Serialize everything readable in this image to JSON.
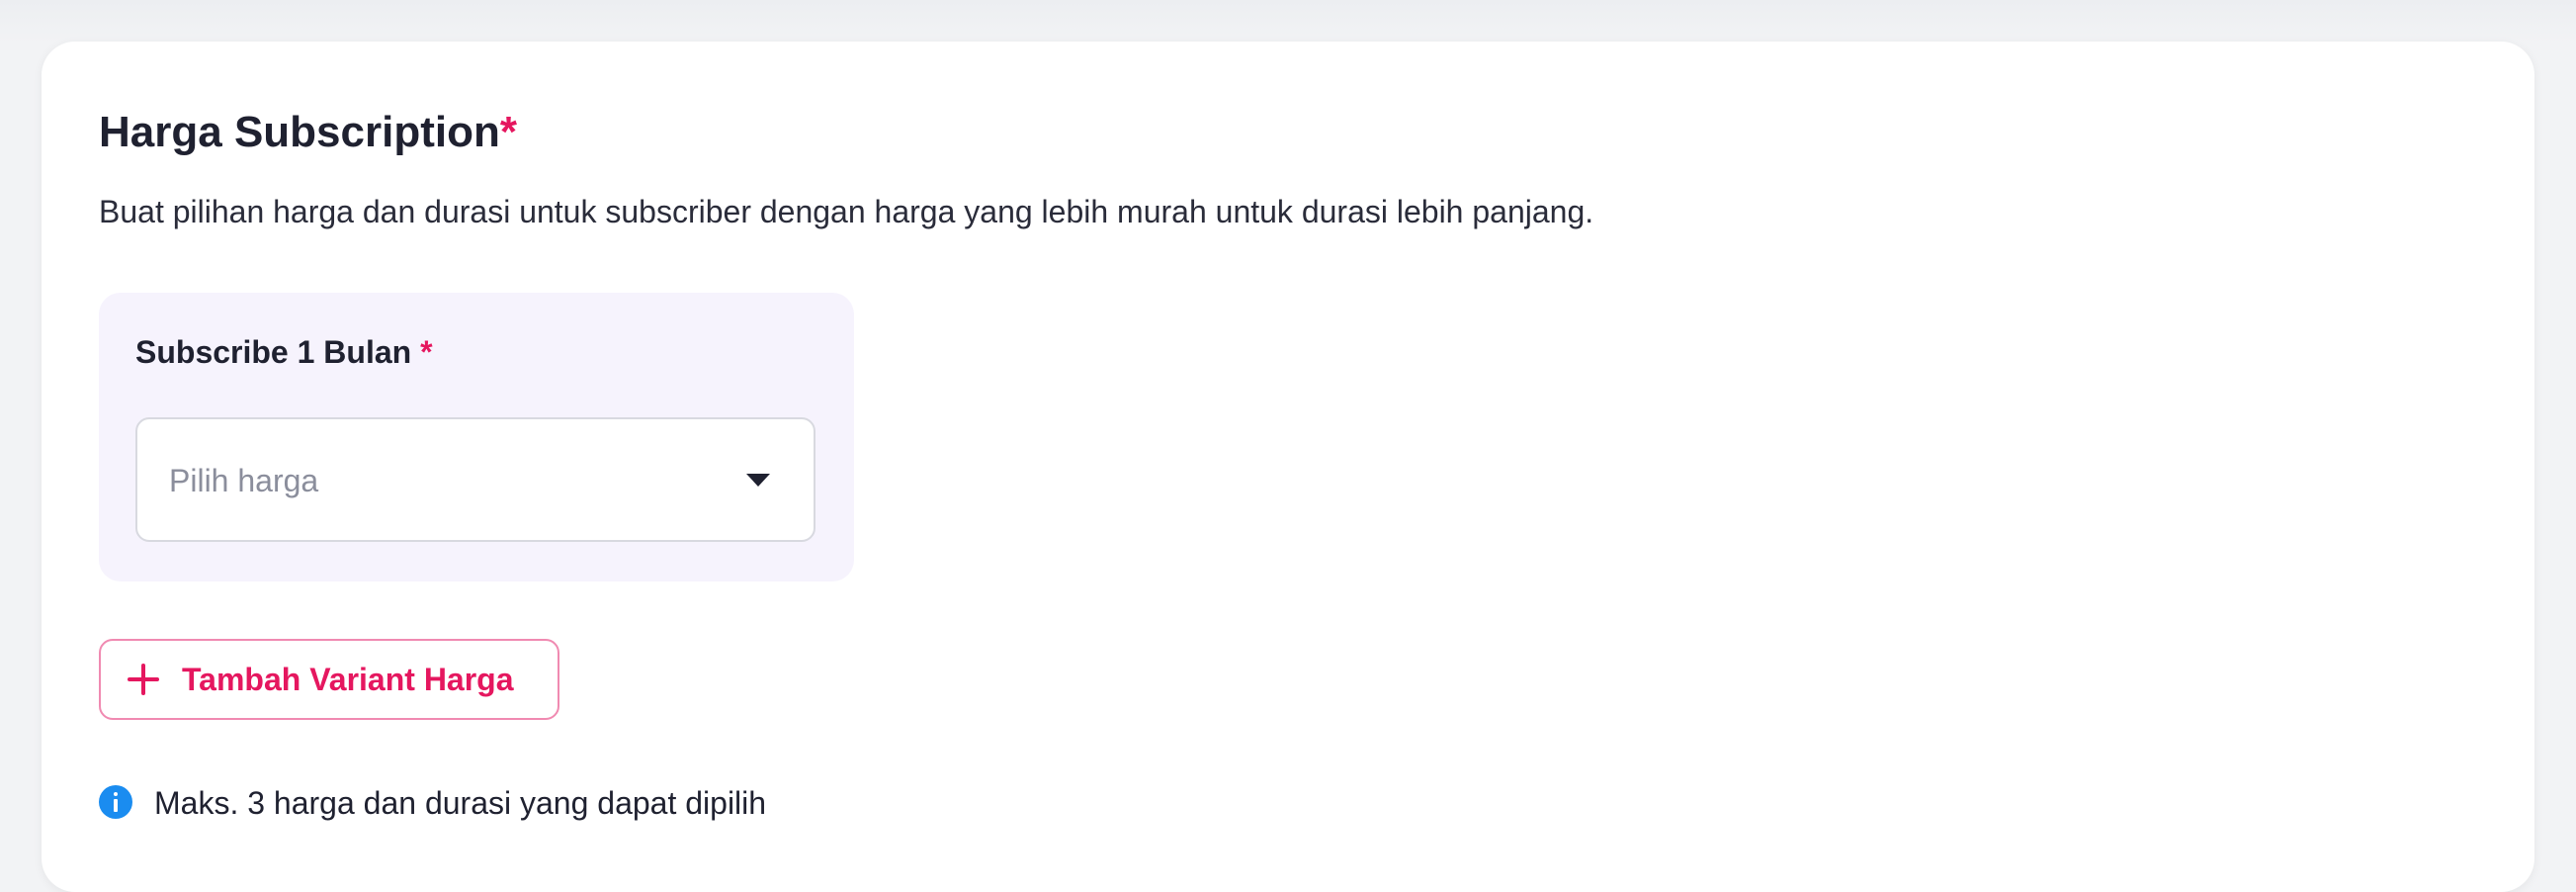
{
  "section": {
    "title": "Harga Subscription",
    "required_marker": "*",
    "description": "Buat pilihan harga dan durasi untuk subscriber dengan harga yang lebih murah untuk durasi lebih panjang."
  },
  "variants": [
    {
      "label": "Subscribe 1 Bulan",
      "required_marker": "*",
      "select": {
        "placeholder": "Pilih harga",
        "icon": "caret-down-icon"
      }
    }
  ],
  "add_variant_button": {
    "label": "Tambah Variant Harga",
    "icon": "plus-icon"
  },
  "info": {
    "icon": "info-icon",
    "text": "Maks. 3 harga dan durasi yang dapat dipilih"
  },
  "colors": {
    "accent": "#e5175f",
    "variant_background": "#f6f3fd",
    "info": "#1a8cf0"
  }
}
